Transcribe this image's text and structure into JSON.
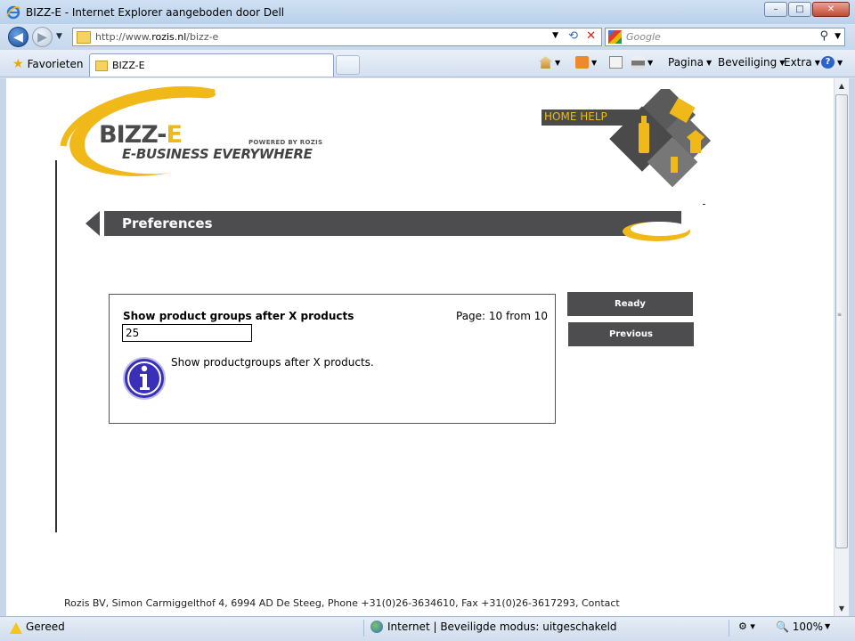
{
  "window": {
    "title": "BIZZ-E - Internet Explorer aangeboden door Dell",
    "buttons": {
      "minimize": "–",
      "maximize": "□",
      "close": "✕"
    }
  },
  "address_bar": {
    "url_prefix": "http://www.",
    "url_domain": "rozis.nl",
    "url_path": "/bizz-e",
    "search_placeholder": "Google"
  },
  "tab_bar": {
    "favorites_label": "Favorieten",
    "active_tab_label": "BIZZ-E",
    "commands": {
      "pagina": "Pagina",
      "beveiliging": "Beveiliging",
      "extra": "Extra"
    }
  },
  "page": {
    "logo": {
      "brand_main": "BIZZ-",
      "brand_e": "E",
      "powered_by": "POWERED BY ROZIS",
      "tagline": "E-BUSINESS EVERYWHERE"
    },
    "home_help_label": "HOME HELP",
    "section_title": "Preferences",
    "form": {
      "field_label": "Show product groups after X products",
      "page_info": "Page: 10 from 10",
      "field_value": "25",
      "help_text": "Show productgroups after X products."
    },
    "buttons": {
      "ready": "Ready",
      "previous": "Previous"
    },
    "footer": "Rozis BV, Simon Carmiggelthof 4, 6994 AD De Steeg, Phone +31(0)26-3634610, Fax +31(0)26-3617293, Contact"
  },
  "status_bar": {
    "status": "Gereed",
    "zone": "Internet | Beveiligde modus: uitgeschakeld",
    "zoom": "100%"
  },
  "colors": {
    "brand_yellow": "#f0b819",
    "brand_dark": "#4d4d4f"
  }
}
